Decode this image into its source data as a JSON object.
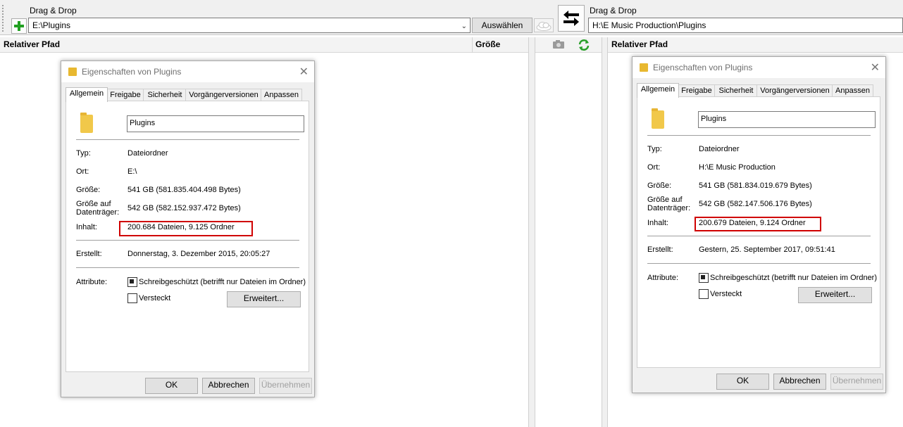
{
  "left_side": {
    "drag_drop_label": "Drag & Drop",
    "path": "E:\\Plugins",
    "select_button": "Auswählen"
  },
  "right_side": {
    "drag_drop_label": "Drag & Drop",
    "path": "H:\\E Music Production\\Plugins"
  },
  "columns": {
    "left_relative_path": "Relativer Pfad",
    "left_size": "Größe",
    "right_relative_path": "Relativer Pfad"
  },
  "icons": {
    "add": "plus-icon",
    "cloud": "cloud-icon",
    "swap": "swap-arrows-icon",
    "compare": "camera-icon",
    "refresh": "refresh-icon",
    "folder": "folder-icon",
    "close": "close-icon"
  },
  "colors": {
    "highlight": "#d00000",
    "refresh_green": "#2aa02a",
    "folder_yellow": "#f1c84a"
  },
  "dialog_left": {
    "title": "Eigenschaften von Plugins",
    "close": "✕",
    "tabs": [
      "Allgemein",
      "Freigabe",
      "Sicherheit",
      "Vorgängerversionen",
      "Anpassen"
    ],
    "name": "Plugins",
    "labels": {
      "type": "Typ:",
      "location": "Ort:",
      "size": "Größe:",
      "size_on_disk_1": "Größe auf",
      "size_on_disk_2": "Datenträger:",
      "contents": "Inhalt:",
      "created": "Erstellt:",
      "attributes": "Attribute:"
    },
    "type": "Dateiordner",
    "location": "E:\\",
    "size": "541 GB (581.835.404.498 Bytes)",
    "size_on_disk": "542 GB (582.152.937.472 Bytes)",
    "contents": "200.684 Dateien, 9.125 Ordner",
    "created": "Donnerstag, 3. Dezember 2015, 20:05:27",
    "readonly": "Schreibgeschützt (betrifft nur Dateien im Ordner)",
    "hidden": "Versteckt",
    "advanced": "Erweitert...",
    "ok": "OK",
    "cancel": "Abbrechen",
    "apply": "Übernehmen"
  },
  "dialog_right": {
    "title": "Eigenschaften von Plugins",
    "close": "✕",
    "tabs": [
      "Allgemein",
      "Freigabe",
      "Sicherheit",
      "Vorgängerversionen",
      "Anpassen"
    ],
    "name": "Plugins",
    "labels": {
      "type": "Typ:",
      "location": "Ort:",
      "size": "Größe:",
      "size_on_disk_1": "Größe auf",
      "size_on_disk_2": "Datenträger:",
      "contents": "Inhalt:",
      "created": "Erstellt:",
      "attributes": "Attribute:"
    },
    "type": "Dateiordner",
    "location": "H:\\E Music Production",
    "size": "541 GB (581.834.019.679 Bytes)",
    "size_on_disk": "542 GB (582.147.506.176 Bytes)",
    "contents": "200.679 Dateien, 9.124 Ordner",
    "created": "Gestern, 25. September 2017, 09:51:41",
    "readonly": "Schreibgeschützt (betrifft nur Dateien im Ordner)",
    "hidden": "Versteckt",
    "advanced": "Erweitert...",
    "ok": "OK",
    "cancel": "Abbrechen",
    "apply": "Übernehmen"
  }
}
